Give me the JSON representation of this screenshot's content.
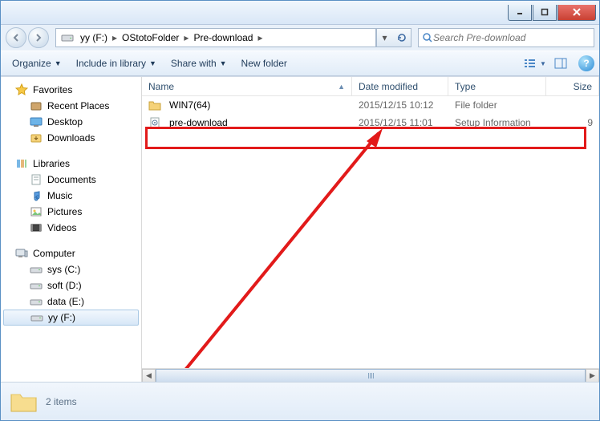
{
  "breadcrumbs": [
    "yy (F:)",
    "OStotoFolder",
    "Pre-download"
  ],
  "search_placeholder": "Search Pre-download",
  "toolbar": {
    "organize": "Organize",
    "include": "Include in library",
    "share": "Share with",
    "newfolder": "New folder"
  },
  "columns": {
    "name": "Name",
    "date": "Date modified",
    "type": "Type",
    "size": "Size"
  },
  "sidebar": {
    "favorites": {
      "label": "Favorites",
      "items": [
        "Recent Places",
        "Desktop",
        "Downloads"
      ]
    },
    "libraries": {
      "label": "Libraries",
      "items": [
        "Documents",
        "Music",
        "Pictures",
        "Videos"
      ]
    },
    "computer": {
      "label": "Computer",
      "items": [
        "sys (C:)",
        "soft (D:)",
        "data (E:)",
        "yy (F:)"
      ]
    }
  },
  "files": [
    {
      "name": "WIN7(64)",
      "date": "2015/12/15 10:12",
      "type": "File folder",
      "size": ""
    },
    {
      "name": "pre-download",
      "date": "2015/12/15 11:01",
      "type": "Setup Information",
      "size": "9"
    }
  ],
  "status_count": "2 items"
}
